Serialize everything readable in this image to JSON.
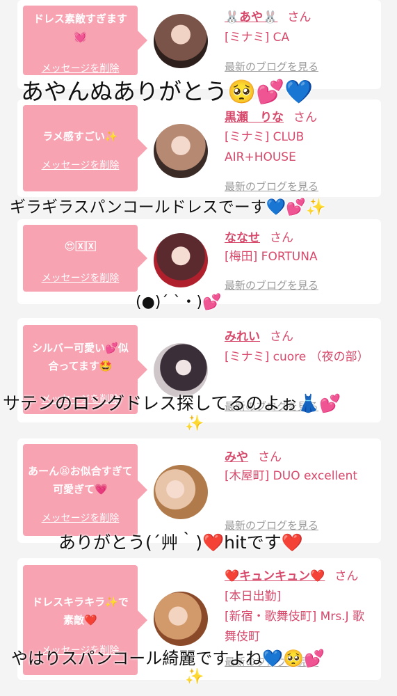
{
  "cards": [
    {
      "message": "ドレス素敵すぎます💓",
      "delete_label": "メッセージを削除",
      "name": "🐰あや🐰",
      "san": "さん",
      "shop": "[ミナミ] CA",
      "blog": "最新のブログを見る"
    },
    {
      "message": "ラメ感すごい✨",
      "delete_label": "メッセージを削除",
      "name": "黒瀬　りな",
      "san": "さん",
      "shop": "[ミナミ] CLUB AIR+HOUSE",
      "blog": "最新のブログを見る"
    },
    {
      "message": "😍🅇🅇",
      "delete_label": "メッセージを削除",
      "name": "ななせ",
      "san": "さん",
      "shop": "[梅田] FORTUNA",
      "blog": "最新のブログを見る"
    },
    {
      "message": "シルバー可愛い💕似合ってます🤩",
      "delete_label": "メッセージを削除",
      "name": "みれい",
      "san": "さん",
      "shop": "[ミナミ] cuore （夜の部）",
      "blog": "最新のブログを見る"
    },
    {
      "message": "あーん😫お似合すぎて可愛ぎて💗",
      "delete_label": "メッセージを削除",
      "name": "みや",
      "san": "さん",
      "shop": "[木屋町] DUO excellent",
      "blog": "最新のブログを見る"
    },
    {
      "message": "ドレスキラキラ✨で素敵❤️",
      "delete_label": "メッセージを削除",
      "name": "❤️キュンキュン❤️",
      "san": "さん",
      "shop_prefix": "[本日出勤]",
      "shop": "[新宿・歌舞伎町] Mrs.J 歌舞伎町",
      "blog": "最新のブログを見る"
    }
  ],
  "overlays": [
    "あやんぬありがとう🥺💕💙",
    "ギラギラスパンコールドレスでーす💙💕✨",
    "(●)´ ˋ・)💕",
    "サテンのロングドレス探してるのよぉ👗💕",
    "✨",
    "ありがとう(´艸｀)❤️hitです❤️",
    "やはりスパンコール綺麗ですよね💙🥺💕",
    "✨"
  ]
}
